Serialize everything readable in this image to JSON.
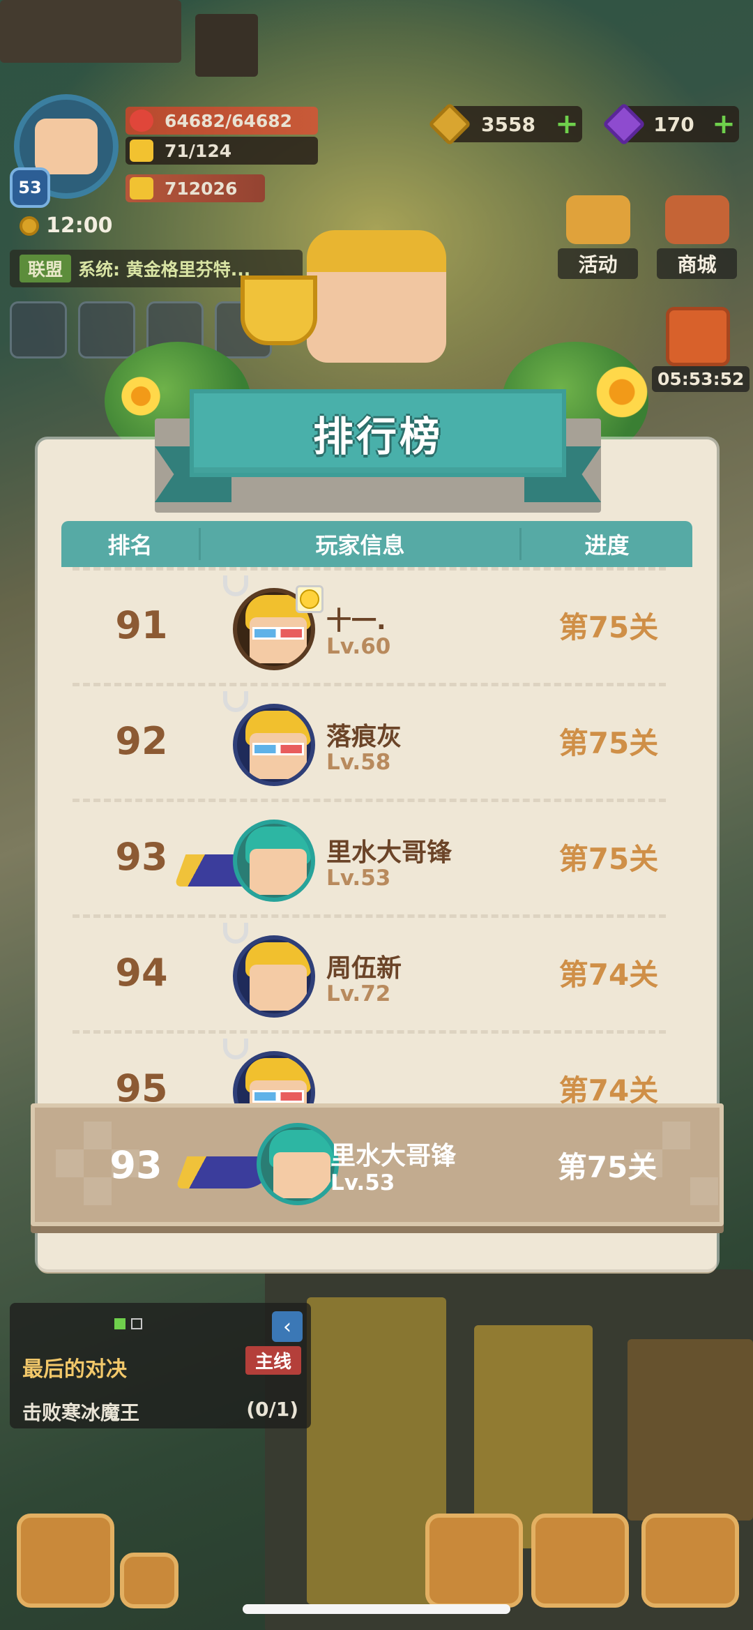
{
  "hud": {
    "hp": "64682/64682",
    "stamina": "71/124",
    "trophies": "712026",
    "player_level": "53",
    "clock": "12:00",
    "gold": "3558",
    "gems": "170",
    "activity_label": "活动",
    "shop_label": "商城",
    "chest_timer": "05:53:52",
    "chat_tag": "联盟",
    "chat_message": "系统: 黄金格里芬特..."
  },
  "leaderboard": {
    "title": "排行榜",
    "columns": [
      "排名",
      "玩家信息",
      "进度"
    ],
    "rows": [
      {
        "rank": "91",
        "name": "十一.",
        "level": "Lv.60",
        "progress": "第75关"
      },
      {
        "rank": "92",
        "name": "落痕灰",
        "level": "Lv.58",
        "progress": "第75关"
      },
      {
        "rank": "93",
        "name": "里水大哥锋",
        "level": "Lv.53",
        "progress": "第75关"
      },
      {
        "rank": "94",
        "name": "周伍新",
        "level": "Lv.72",
        "progress": "第74关"
      },
      {
        "rank": "95",
        "name": "",
        "level": "",
        "progress": "第74关"
      }
    ],
    "self": {
      "rank": "93",
      "name": "里水大哥锋",
      "level": "Lv.53",
      "progress": "第75关"
    }
  },
  "quest": {
    "title": "最后的对决",
    "tag": "主线",
    "objective": "击败寒冰魔王",
    "count": "(0/1)"
  }
}
